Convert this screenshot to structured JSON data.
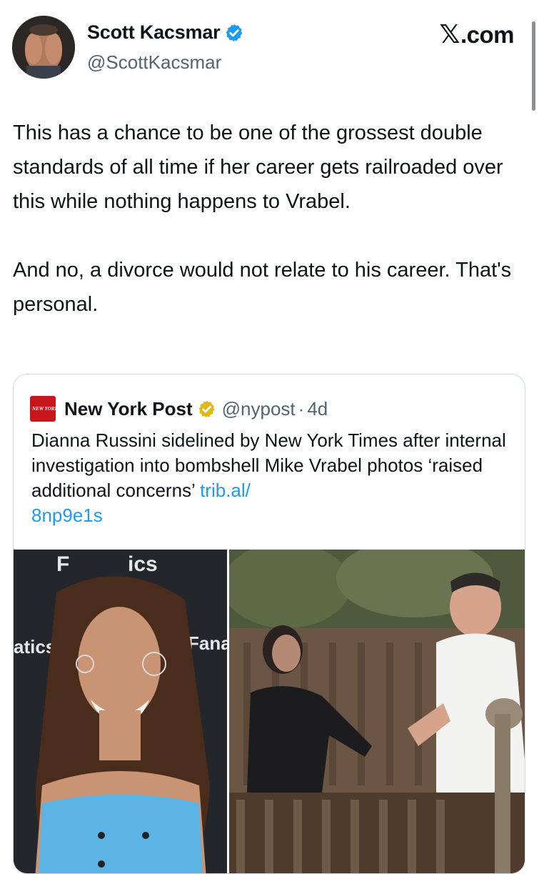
{
  "header": {
    "display_name": "Scott Kacsmar",
    "handle": "@ScottKacsmar",
    "brand_text": ".com",
    "brand_logo_glyph": "𝕏"
  },
  "tweet": {
    "text": "This has a chance to be one of the grossest double standards of all time if her career gets railroaded over this while nothing happens to Vrabel.\n\nAnd no, a divorce would not relate to his career. That's personal."
  },
  "quote": {
    "author_name": "New York Post",
    "logo_text": "NEW YORK POST",
    "handle": "@nypost",
    "separator": "·",
    "time": "4d",
    "text": "Dianna Russini sidelined by New York Times after internal investigation into bombshell Mike Vrabel photos ‘raised additional concerns’ ",
    "link": "trib.al/\n8np9e1s"
  },
  "media": {
    "left_backdrop_text": [
      "F",
      "ics",
      "atics",
      "Fana"
    ]
  },
  "colors": {
    "verified_blue": "#1d9bf0",
    "verified_gold": "#e2b719",
    "link_blue": "#1d9bf0",
    "nyp_red": "#c8161d",
    "text_primary": "#0f1419",
    "text_secondary": "#536471"
  },
  "icons": {
    "verified": "verified-badge-icon",
    "gold_verified": "gold-verified-badge-icon",
    "x_logo": "x-logo-icon"
  }
}
